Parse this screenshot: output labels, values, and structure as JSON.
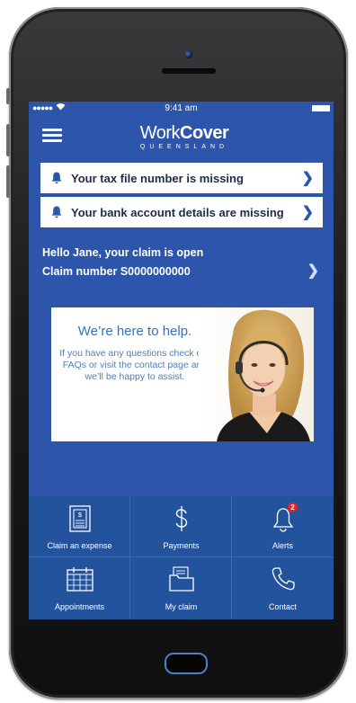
{
  "status_bar": {
    "signal": "●●●●●",
    "time": "9:41 am"
  },
  "header": {
    "logo_light": "Work",
    "logo_bold": "Cover",
    "logo_sub": "QUEENSLAND"
  },
  "notices": [
    {
      "text": "Your tax file number is missing"
    },
    {
      "text": "Your bank account details are missing"
    }
  ],
  "claim": {
    "greeting": "Hello Jane, your claim is open",
    "number": "Claim number S0000000000"
  },
  "help_panel": {
    "title": "We’re here to help.",
    "body": "If you have any questions check our FAQs or visit the contact page and we’ll be happy to assist."
  },
  "nav_grid": [
    {
      "label": "Claim an expense",
      "icon": "receipt-icon"
    },
    {
      "label": "Payments",
      "icon": "dollar-icon"
    },
    {
      "label": "Alerts",
      "icon": "bell-icon",
      "badge": "2"
    },
    {
      "label": "Appointments",
      "icon": "calendar-icon"
    },
    {
      "label": "My claim",
      "icon": "folder-icon"
    },
    {
      "label": "Contact",
      "icon": "phone-icon"
    }
  ],
  "colors": {
    "screen_bg": "#2e55ac",
    "grid_bg": "#24539e",
    "badge": "#e4202b",
    "help_text": "#3573b7"
  }
}
